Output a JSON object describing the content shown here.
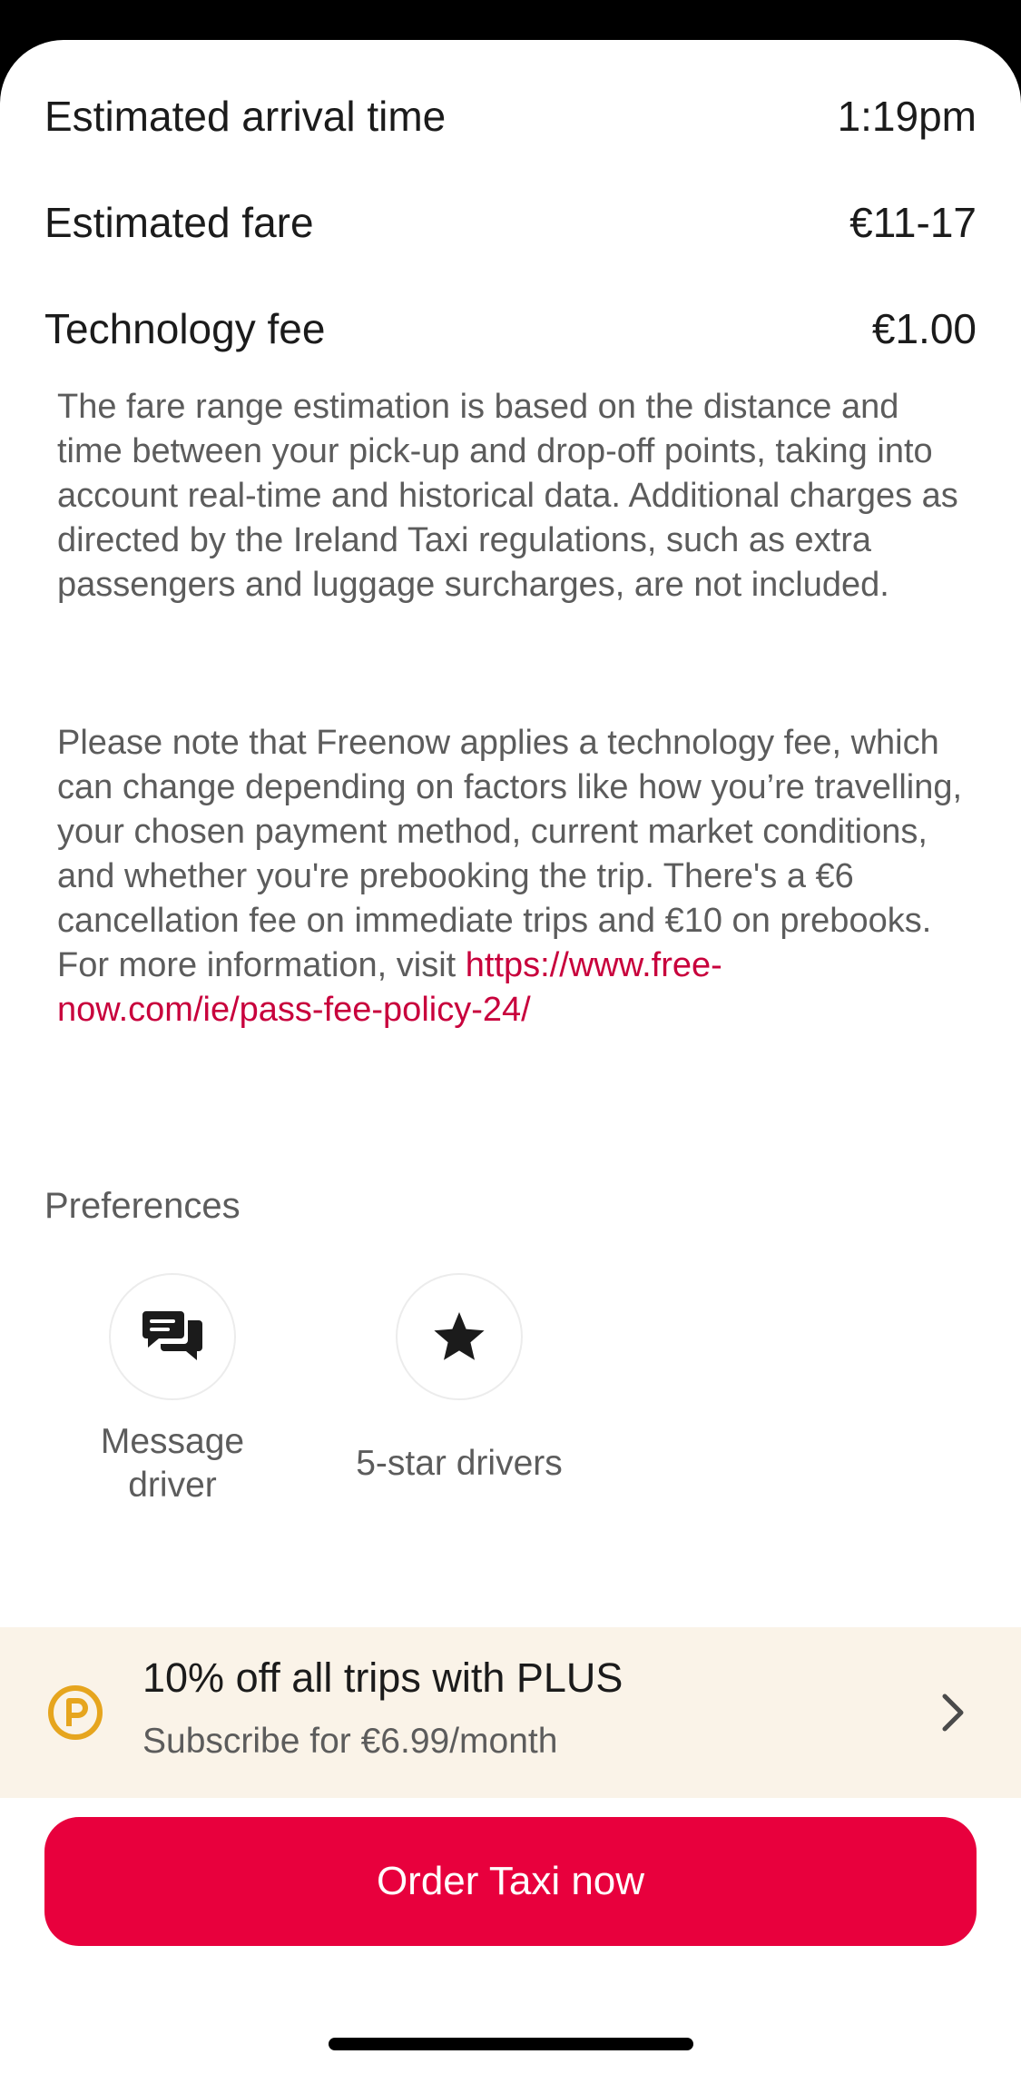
{
  "summary": {
    "arrival_label": "Estimated arrival time",
    "arrival_value": "1:19pm",
    "fare_label": "Estimated fare",
    "fare_value": "€11-17",
    "fee_label": "Technology fee",
    "fee_value": "€1.00"
  },
  "info": {
    "paragraph1": "The fare range estimation is based on the distance and time between your pick-up and drop-off points, taking into account real-time and historical data. Additional charges as directed by the Ireland Taxi regulations, such as extra passengers and luggage surcharges, are not included.",
    "paragraph2_text": "Please note that Freenow applies a technology fee, which can change depending on factors like how you’re travelling, your chosen payment method, current market conditions, and whether you're prebooking the trip. There's a €6 cancellation fee on immediate trips and €10 on prebooks. For more information, visit ",
    "paragraph2_link": "https://www.free-now.com/ie/pass-fee-policy-24/"
  },
  "preferences": {
    "title": "Preferences",
    "items": [
      {
        "label": "Message driver",
        "icon": "message-icon"
      },
      {
        "label": "5-star drivers",
        "icon": "star-icon"
      }
    ]
  },
  "promo": {
    "title": "10% off all trips with PLUS",
    "subtitle": "Subscribe for €6.99/month",
    "icon": "plus-logo-icon"
  },
  "order_button": {
    "label": "Order Taxi now"
  },
  "colors": {
    "accent": "#e8003d",
    "link": "#c8003c",
    "promo_bg": "#faf3e8",
    "promo_logo": "#e6a51e"
  }
}
